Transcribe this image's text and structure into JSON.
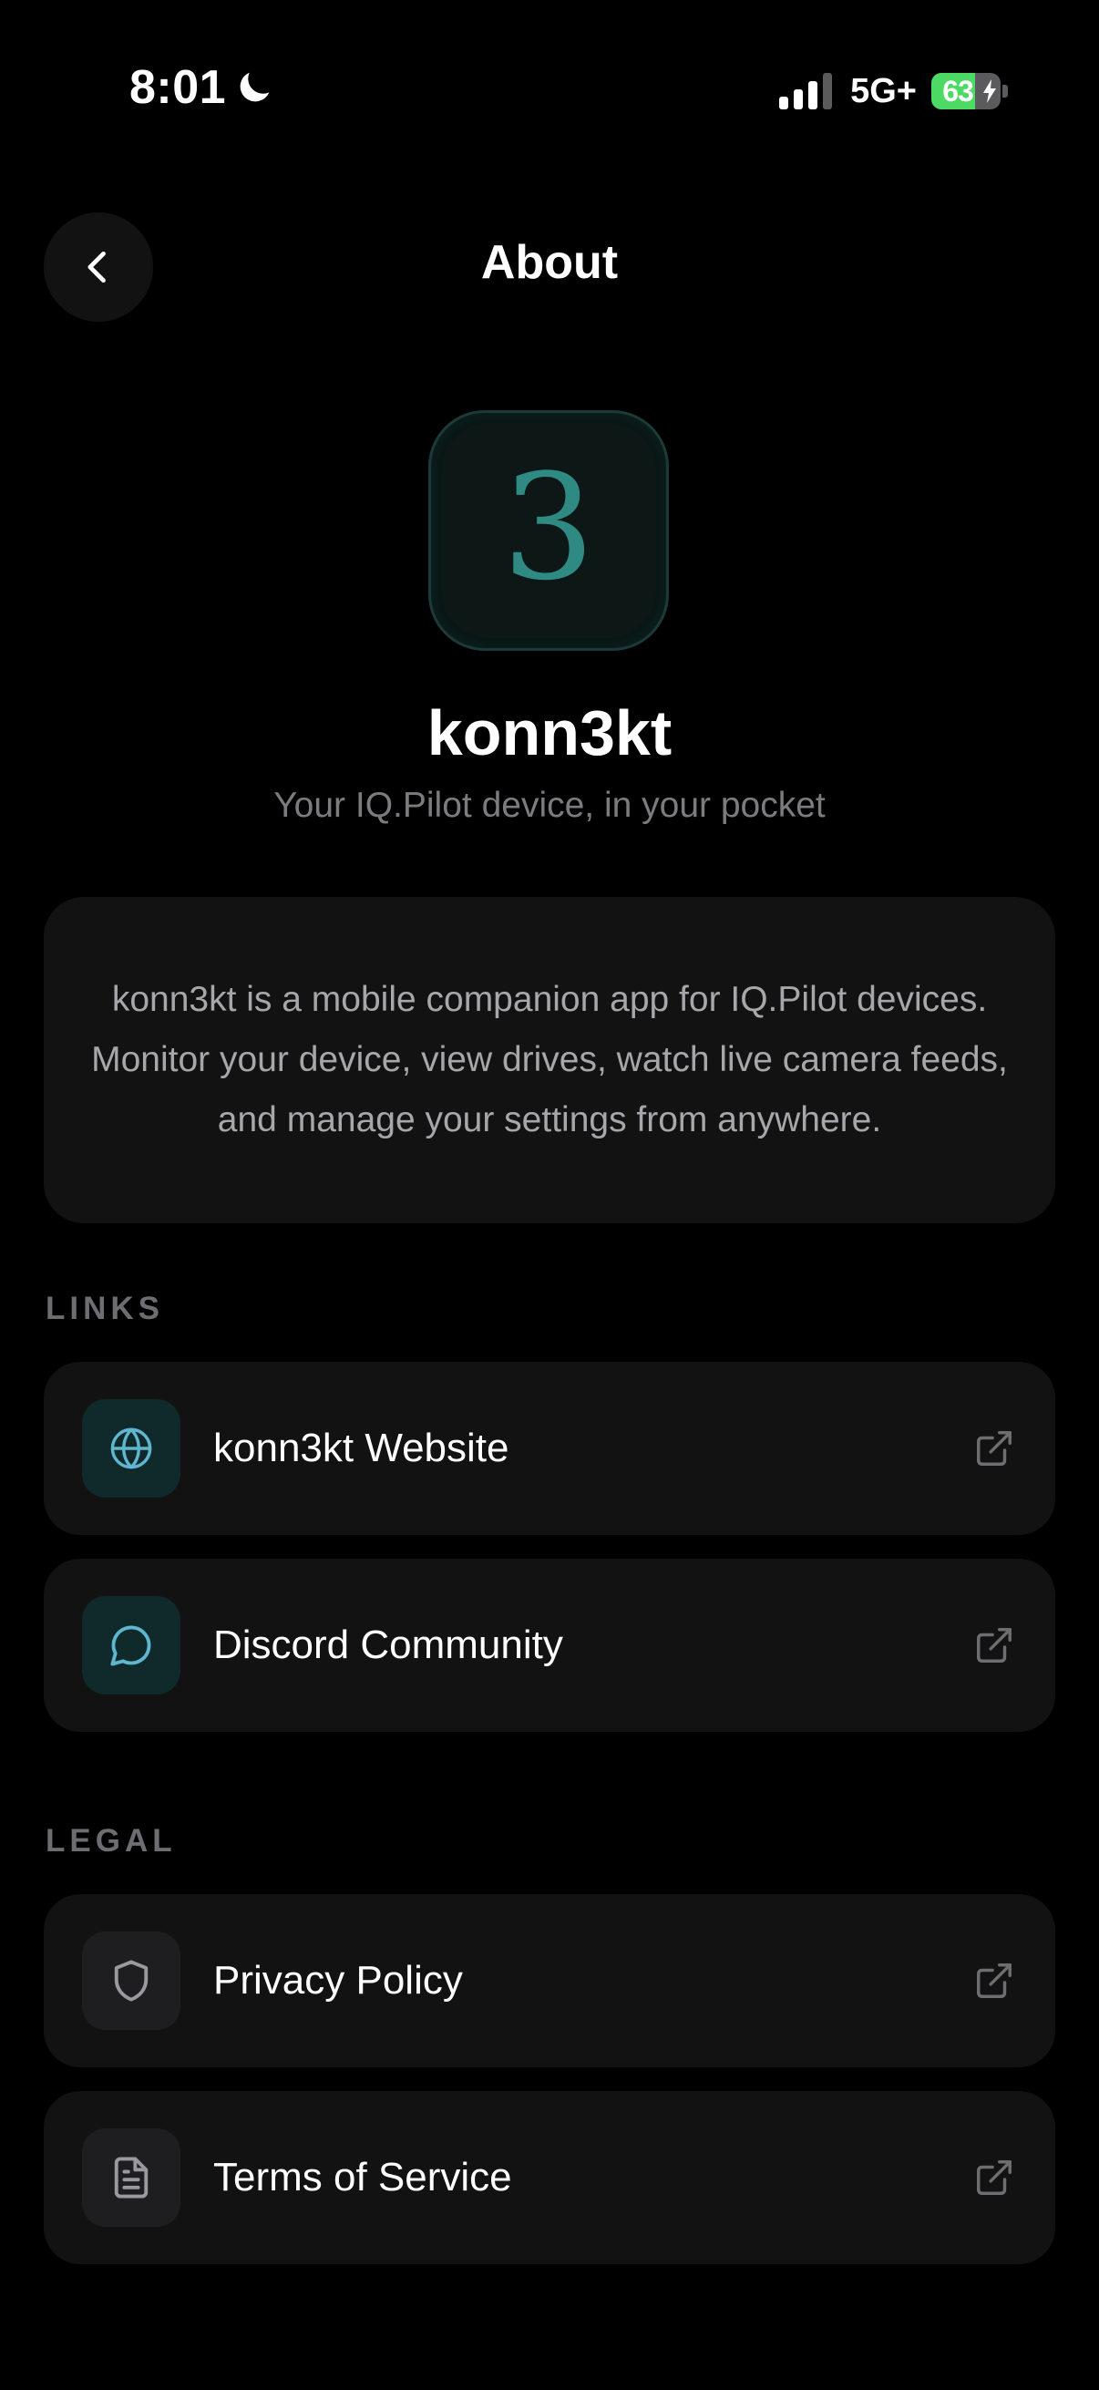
{
  "status_bar": {
    "time": "8:01",
    "network": "5G+",
    "battery_level": "63",
    "battery_fraction": 0.63,
    "battery_color": "#4cd964"
  },
  "header": {
    "title": "About",
    "back_icon": "chevron-left-icon"
  },
  "app": {
    "logo_glyph": "3",
    "name": "konn3kt",
    "tagline": "Your IQ.Pilot device, in your pocket",
    "description": "konn3kt is a mobile companion app for IQ.Pilot devices. Monitor your device, view drives, watch live camera feeds, and manage your settings from anywhere.",
    "accent_color": "#2f8a84"
  },
  "sections": {
    "links": {
      "label": "LINKS",
      "items": [
        {
          "label": "konn3kt Website",
          "icon": "globe-icon",
          "trailing_icon": "external-link-icon"
        },
        {
          "label": "Discord Community",
          "icon": "chat-bubble-icon",
          "trailing_icon": "external-link-icon"
        }
      ]
    },
    "legal": {
      "label": "LEGAL",
      "items": [
        {
          "label": "Privacy Policy",
          "icon": "shield-icon",
          "trailing_icon": "external-link-icon"
        },
        {
          "label": "Terms of Service",
          "icon": "document-icon",
          "trailing_icon": "external-link-icon"
        }
      ]
    }
  }
}
